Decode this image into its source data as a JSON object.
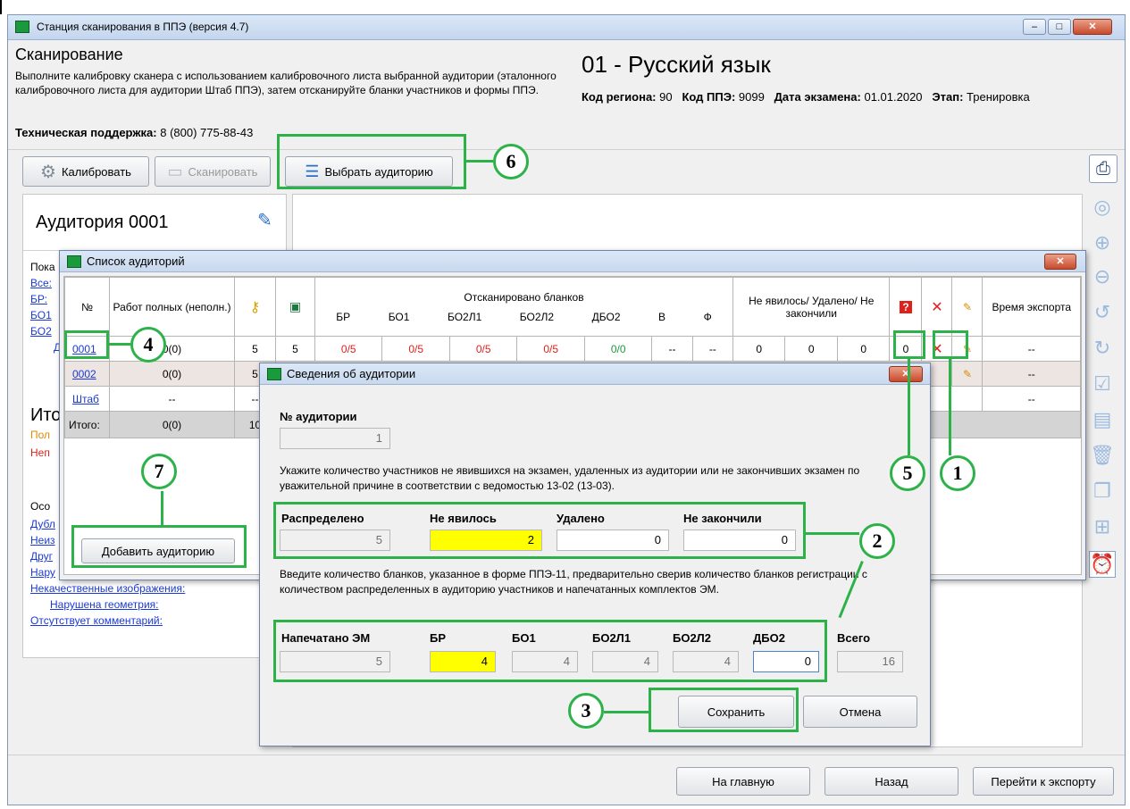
{
  "window": {
    "title": "Станция сканирования в ППЭ (версия 4.7)",
    "btn_min": "–",
    "btn_max": "□",
    "btn_close": "✕"
  },
  "header": {
    "heading": "Сканирование",
    "instructions": "Выполните калибровку сканера с использованием калибровочного листа выбранной аудитории (эталонного калибровочного листа для аудитории Штаб ППЭ), затем отсканируйте бланки участников и формы ППЭ.",
    "support_label": "Техническая поддержка:",
    "support_phone": "8 (800) 775-88-43",
    "subject": "01 - Русский язык",
    "region_label": "Код региона:",
    "region": "90",
    "ppe_label": "Код ППЭ:",
    "ppe": "9099",
    "date_label": "Дата экзамена:",
    "date": "01.01.2020",
    "stage_label": "Этап:",
    "stage": "Тренировка"
  },
  "toolbar": {
    "calibrate": "Калибровать",
    "scan": "Сканировать",
    "select_room": "Выбрать аудиторию"
  },
  "left": {
    "room_title": "Аудитория 0001",
    "show_label": "Пока",
    "links": [
      "Все:",
      "БР:",
      "БО1",
      "БО2"
    ],
    "d": "Д",
    "totals_heading": "Ито",
    "pol": "Пол",
    "neg": "Неп",
    "special": "Осо",
    "special_links": [
      "Дубл",
      "Неиз",
      "Друг",
      "Нару"
    ],
    "bad_images": "Некачественные изображения:",
    "broken_geometry": "Нарушена геометрия:",
    "no_comment": "Отсутствует комментарий:"
  },
  "rooms_dialog": {
    "title": "Список аудиторий",
    "col_no": "№",
    "col_works": "Работ полных (неполн.)",
    "col_scanned": "Отсканировано бланков",
    "sub_cols": [
      "БР",
      "БО1",
      "БО2Л1",
      "БО2Л2",
      "ДБО2",
      "В",
      "Ф"
    ],
    "col_absent": "Не явилось/ Удалено/ Не закончили",
    "col_export": "Время экспорта",
    "rows": [
      {
        "no": "0001",
        "works": "0(0)",
        "keys": "5",
        "saved": "5",
        "br": "0/5",
        "bo1": "0/5",
        "bo2l1": "0/5",
        "bo2l2": "0/5",
        "dbo2": "0/0",
        "v": "--",
        "f": "--",
        "a1": "0",
        "a2": "0",
        "a3": "0",
        "q": "0",
        "export": "--"
      },
      {
        "no": "0002",
        "works": "0(0)",
        "keys": "5",
        "export": "--"
      },
      {
        "no": "Штаб",
        "works": "--",
        "keys": "--",
        "export": "--"
      }
    ],
    "total_label": "Итого:",
    "total_works": "0(0)",
    "total_keys": "10",
    "add_room": "Добавить аудиторию"
  },
  "info_dialog": {
    "title": "Сведения об аудитории",
    "room_no_label": "№ аудитории",
    "room_no": "1",
    "text1": "Укажите количество участников не явившихся на экзамен, удаленных из аудитории или не закончивших экзамен по уважительной причине в соответствии с ведомостью 13-02 (13-03).",
    "labels1": [
      "Распределено",
      "Не явилось",
      "Удалено",
      "Не закончили"
    ],
    "values1": [
      "5",
      "2",
      "0",
      "0"
    ],
    "text2": "Введите количество бланков, указанное в форме ППЭ-11, предварительно сверив количество бланков регистрации с количеством распределенных в аудиторию участников и напечатанных комплектов ЭМ.",
    "labels2": [
      "Напечатано ЭМ",
      "БР",
      "БО1",
      "БО2Л1",
      "БО2Л2",
      "ДБО2",
      "Всего"
    ],
    "values2": [
      "5",
      "4",
      "4",
      "4",
      "4",
      "0",
      "16"
    ],
    "save": "Сохранить",
    "cancel": "Отмена"
  },
  "footer": {
    "home": "На главную",
    "back": "Назад",
    "export": "Перейти к экспорту"
  },
  "callouts": [
    "1",
    "2",
    "3",
    "4",
    "5",
    "6",
    "7"
  ],
  "colors": {
    "highlight": "#2db24a",
    "yellow": "#ffff00",
    "red": "#e0201a"
  }
}
